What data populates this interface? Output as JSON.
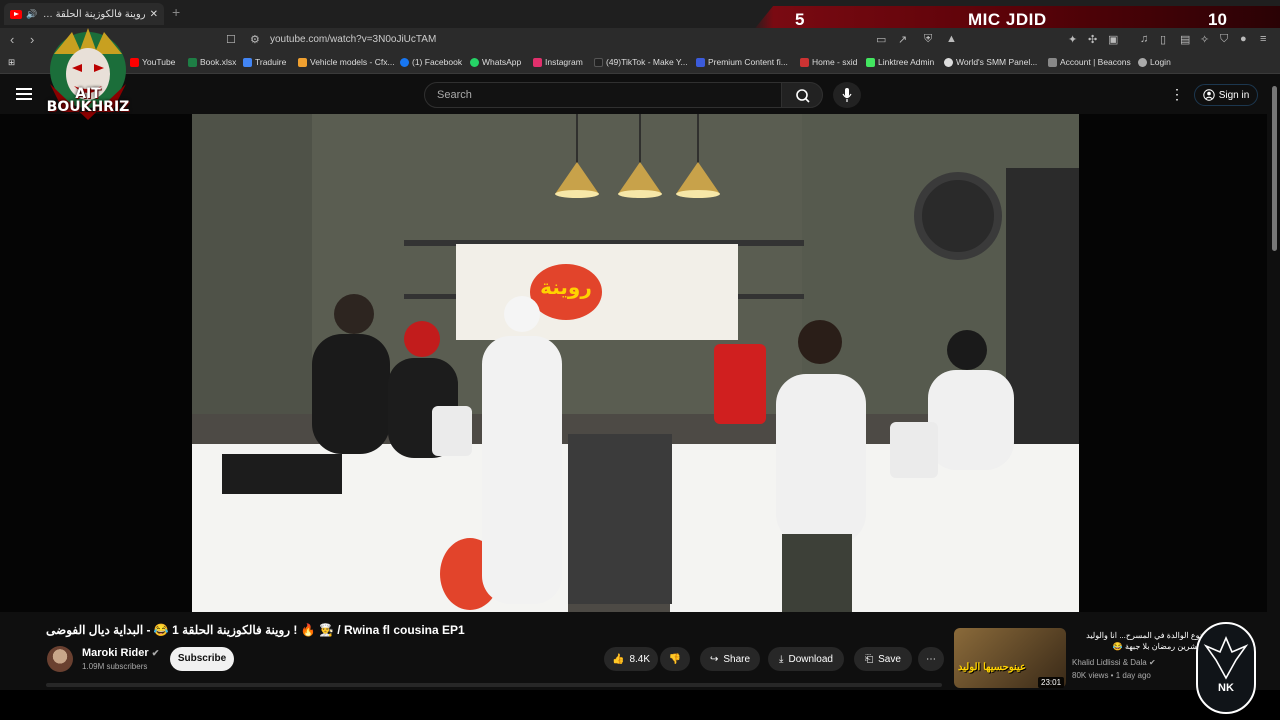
{
  "browser": {
    "tab_title": "روينة فالكوزينة الحلقة 1 😂 - البد",
    "url": "youtube.com/watch?v=3N0oJiUcTAM"
  },
  "scoreboard": {
    "left_score": "5",
    "title": "MIC JDID",
    "right_score": "10"
  },
  "bookmarks": [
    {
      "label": "YouTube",
      "color": "#ff0000"
    },
    {
      "label": "Book.xlsx",
      "color": "#1e7e45"
    },
    {
      "label": "Traduire",
      "color": "#4285f4"
    },
    {
      "label": "Vehicle models - Cfx...",
      "color": "#f0a030"
    },
    {
      "label": "(1) Facebook",
      "color": "#1877f2"
    },
    {
      "label": "WhatsApp",
      "color": "#25d366"
    },
    {
      "label": "Instagram",
      "color": "#e1306c"
    },
    {
      "label": "(49)TikTok - Make Y...",
      "color": "#222222"
    },
    {
      "label": "Premium Content fi...",
      "color": "#3b5bdb"
    },
    {
      "label": "Home - sxid",
      "color": "#cc3333"
    },
    {
      "label": "Linktree Admin",
      "color": "#43e660"
    },
    {
      "label": "World's SMM Panel...",
      "color": "#dddddd"
    },
    {
      "label": "Account | Beacons",
      "color": "#888888"
    },
    {
      "label": "Login",
      "color": "#aaaaaa"
    }
  ],
  "logo": {
    "line1": "AIT",
    "line2": "BOUKHRIZ"
  },
  "youtube": {
    "search_placeholder": "Search",
    "signin_label": "Sign in"
  },
  "video": {
    "title": "روينة فالكوزينة الحلقة 1 😂 - البداية ديال الفوضى ! 🔥 👨‍🍳 / Rwina fl cousina EP1",
    "channel": "Maroki Rider",
    "subscribers": "1.09M subscribers",
    "subscribe_label": "Subscribe",
    "likes": "8.4K",
    "share_label": "Share",
    "download_label": "Download",
    "save_label": "Save"
  },
  "recommendation": {
    "title": "نوع الوالدة في المسرح... انا والوليد عشرين رمضان بلا جبهة 😂",
    "channel": "Khalid Lidlissi & Dala",
    "meta": "80K views • 1 day ago",
    "duration": "23:01",
    "thumb_text": "عينوحسيها الوليد"
  },
  "badge": {
    "text": "NK"
  },
  "colors": {
    "background": "#0f0f0f",
    "accent": "#ff0000",
    "score_bar": "#5a0208"
  }
}
